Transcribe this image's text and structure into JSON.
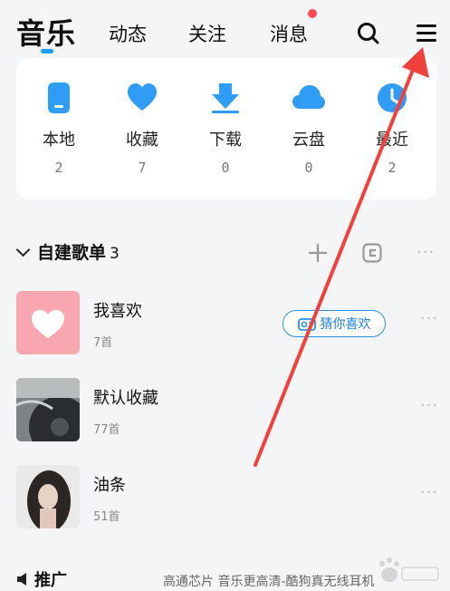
{
  "tabs": [
    {
      "label": "音乐"
    },
    {
      "label": "动态"
    },
    {
      "label": "关注"
    },
    {
      "label": "消息"
    }
  ],
  "icons": {
    "search": "search-icon",
    "menu": "hamburger-menu-icon"
  },
  "quick_access": [
    {
      "label": "本地",
      "count": "2",
      "icon": "phone-icon"
    },
    {
      "label": "收藏",
      "count": "7",
      "icon": "heart-icon"
    },
    {
      "label": "下载",
      "count": "0",
      "icon": "download-icon"
    },
    {
      "label": "云盘",
      "count": "0",
      "icon": "cloud-icon"
    },
    {
      "label": "最近",
      "count": "2",
      "icon": "clock-icon"
    }
  ],
  "playlists_section": {
    "title": "自建歌单",
    "count": "3"
  },
  "playlists": [
    {
      "title": "我喜欢",
      "subtitle": "7首"
    },
    {
      "title": "默认收藏",
      "subtitle": "77首"
    },
    {
      "title": "油条",
      "subtitle": "51首"
    }
  ],
  "guess_button": {
    "label": "猜你喜欢"
  },
  "recommend": {
    "title": "推广",
    "text": "高通芯片 音乐更高清-酷狗真无线耳机"
  },
  "colors": {
    "accent": "#1a9bff",
    "arrow": "#f0413c",
    "badge": "#ff4b55"
  }
}
